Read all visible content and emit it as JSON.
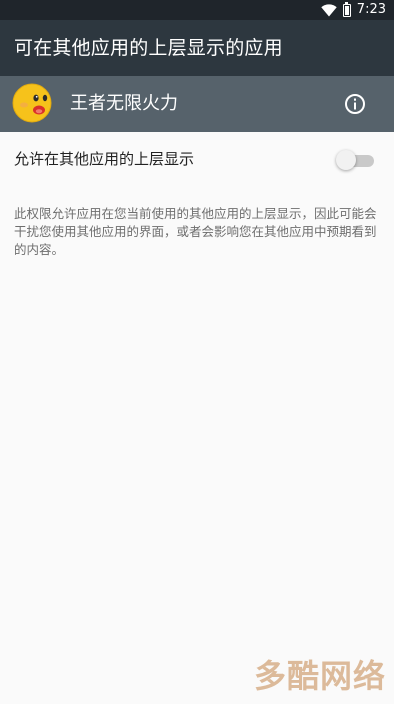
{
  "status_bar": {
    "time": "7:23",
    "icons": [
      "wifi-icon",
      "battery-icon"
    ]
  },
  "toolbar": {
    "title": "可在其他应用的上层显示的应用"
  },
  "app_row": {
    "app_name": "王者无限火力",
    "icon": "app-icon-yellow-face",
    "info_icon": "info-icon"
  },
  "setting": {
    "label": "允许在其他应用的上层显示",
    "toggle_on": false
  },
  "description": "此权限允许应用在您当前使用的其他应用的上层显示，因此可能会干扰您使用其他应用的界面，或者会影响您在其他应用中预期看到的内容。",
  "watermark": "多酷网络",
  "colors": {
    "status_bar": "#1f252b",
    "toolbar": "#2d373f",
    "app_row": "#56626b",
    "background": "#fafafa",
    "watermark": "#d7b08a"
  }
}
